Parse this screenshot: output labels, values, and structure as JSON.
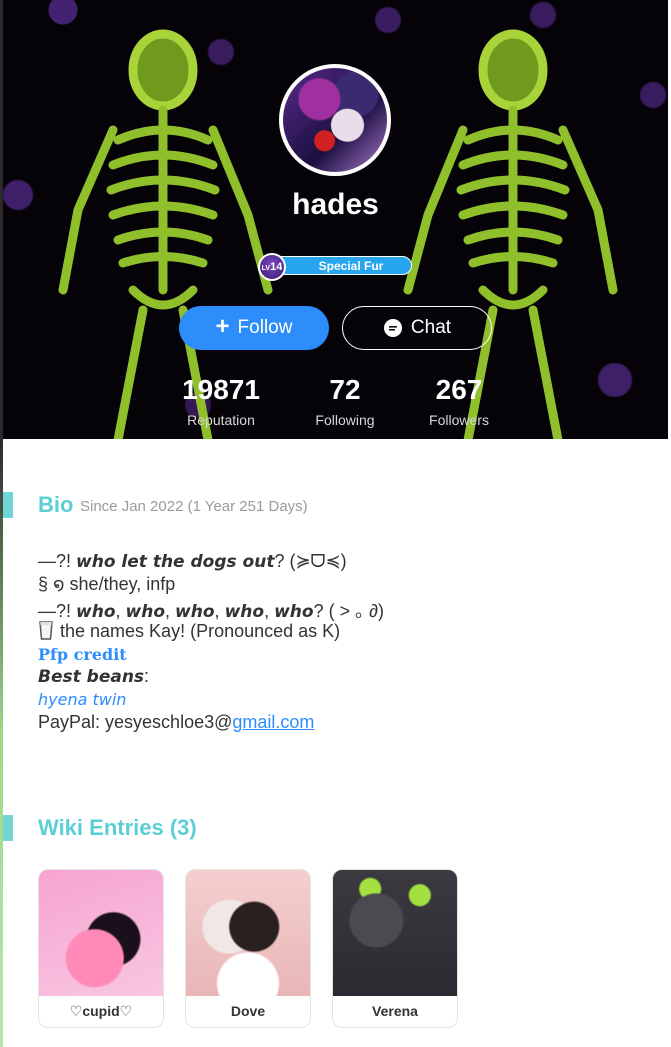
{
  "profile": {
    "username": "hades",
    "level": "14",
    "level_prefix": "LV",
    "title_badge": "Special Fur",
    "follow_label": "Follow",
    "chat_label": "Chat",
    "stats": [
      {
        "value": "19871",
        "label": "Reputation"
      },
      {
        "value": "72",
        "label": "Following"
      },
      {
        "value": "267",
        "label": "Followers"
      }
    ]
  },
  "bio": {
    "title": "Bio",
    "since": "Since Jan 2022 (1 Year 251 Days)",
    "line1_a": "—?! ",
    "line1_b": "who let the dogs out",
    "line1_c": "? (≽ᗜ≼)",
    "line2": "§ ໑ she/they, infp",
    "line3_a": "—?! ",
    "line3_b": "who",
    "line3_c": ", ",
    "line3_d": "who",
    "line3_e": ", ",
    "line3_f": "who",
    "line3_g": ", ",
    "line3_h": "who",
    "line3_i": ", ",
    "line3_j": "who",
    "line3_k": "? ( ˃ ｡ ∂)",
    "line4": "the names Kay! (Pronounced as K)",
    "line5": "Pfp credit",
    "line6_a": "Best beans",
    "line6_b": ":",
    "line7": "hyena twin",
    "line8_a": "PayPal: yesyeschloe3@",
    "line8_link": "gmail.com"
  },
  "wiki": {
    "title": "Wiki Entries (3)",
    "entries": [
      {
        "name": "♡cupid♡"
      },
      {
        "name": "Dove"
      },
      {
        "name": "Verena"
      }
    ]
  },
  "colors": {
    "accent_teal": "#5ccfd6",
    "follow_blue": "#2d8dfb",
    "badge_blue": "#27a6ee"
  }
}
